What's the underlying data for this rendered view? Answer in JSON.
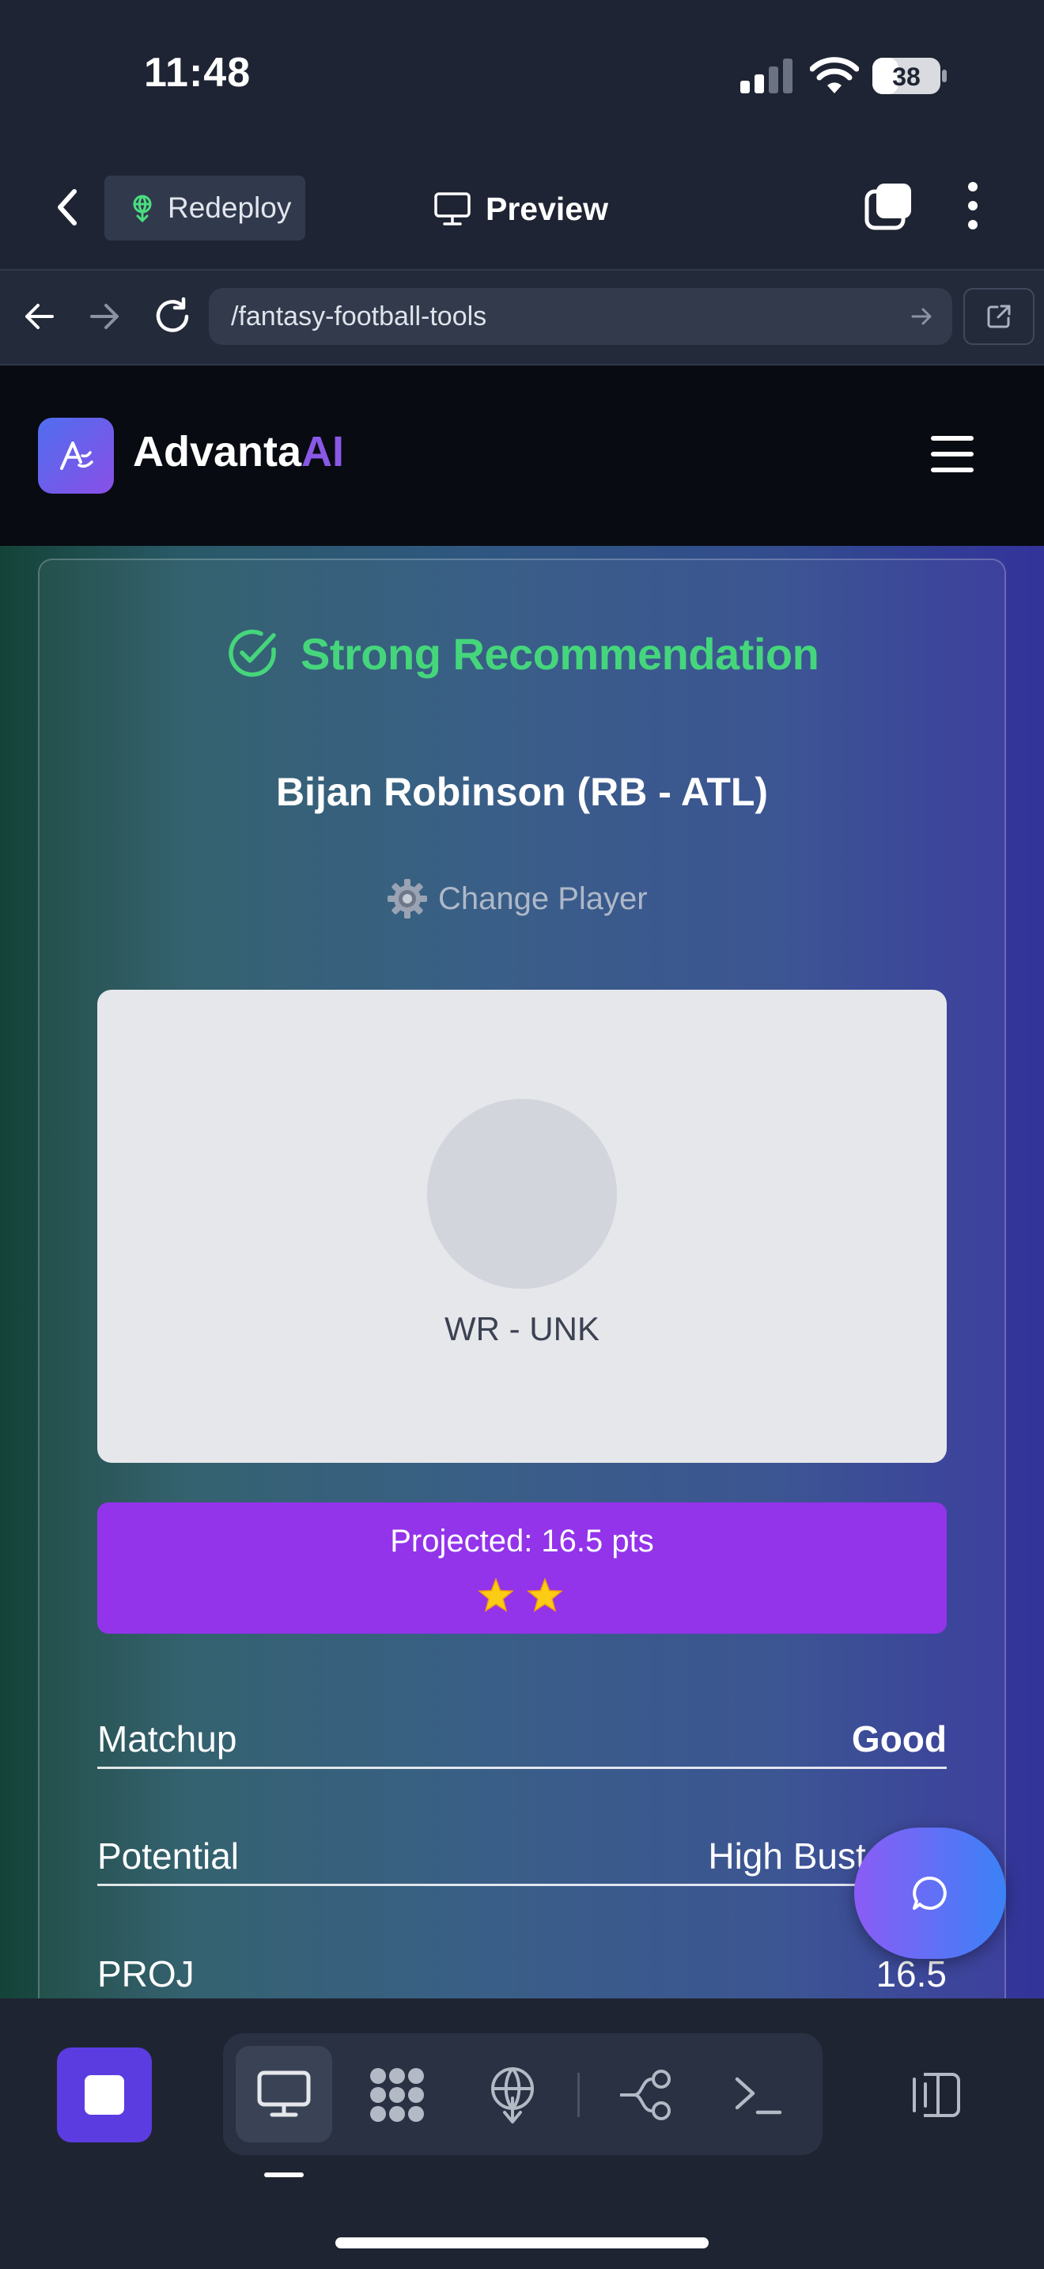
{
  "status_bar": {
    "time": "11:48",
    "battery": "38"
  },
  "app_bar": {
    "redeploy_label": "Redeploy",
    "preview_label": "Preview"
  },
  "browser": {
    "url": "/fantasy-football-tools"
  },
  "site": {
    "brand_main": "Advanta",
    "brand_accent": "AI"
  },
  "recommendation": {
    "label": "Strong Recommendation",
    "player_name": "Bijan Robinson (RB - ATL)",
    "change_player_label": "Change Player",
    "position": "WR - UNK",
    "projected": "Projected: 16.5 pts",
    "star_count": 2
  },
  "stats": [
    {
      "label": "Matchup",
      "value": "Good"
    },
    {
      "label": "Potential",
      "value": "High Bust Risk"
    },
    {
      "label": "PROJ",
      "value": "16.5"
    }
  ],
  "colors": {
    "accent_green": "#45d67c",
    "projected_purple": "#9333ea",
    "brand_ai_purple": "#8a58e6",
    "stop_button": "#5b3ce0"
  },
  "icons": {
    "app_bar": [
      "back-chevron-icon",
      "redeploy-icon",
      "monitor-icon",
      "tabs-icon",
      "more-icon"
    ],
    "toolbar": [
      "desktop-icon",
      "apps-icon",
      "deploy-icon",
      "flow-icon",
      "terminal-icon",
      "split-view-icon"
    ]
  }
}
